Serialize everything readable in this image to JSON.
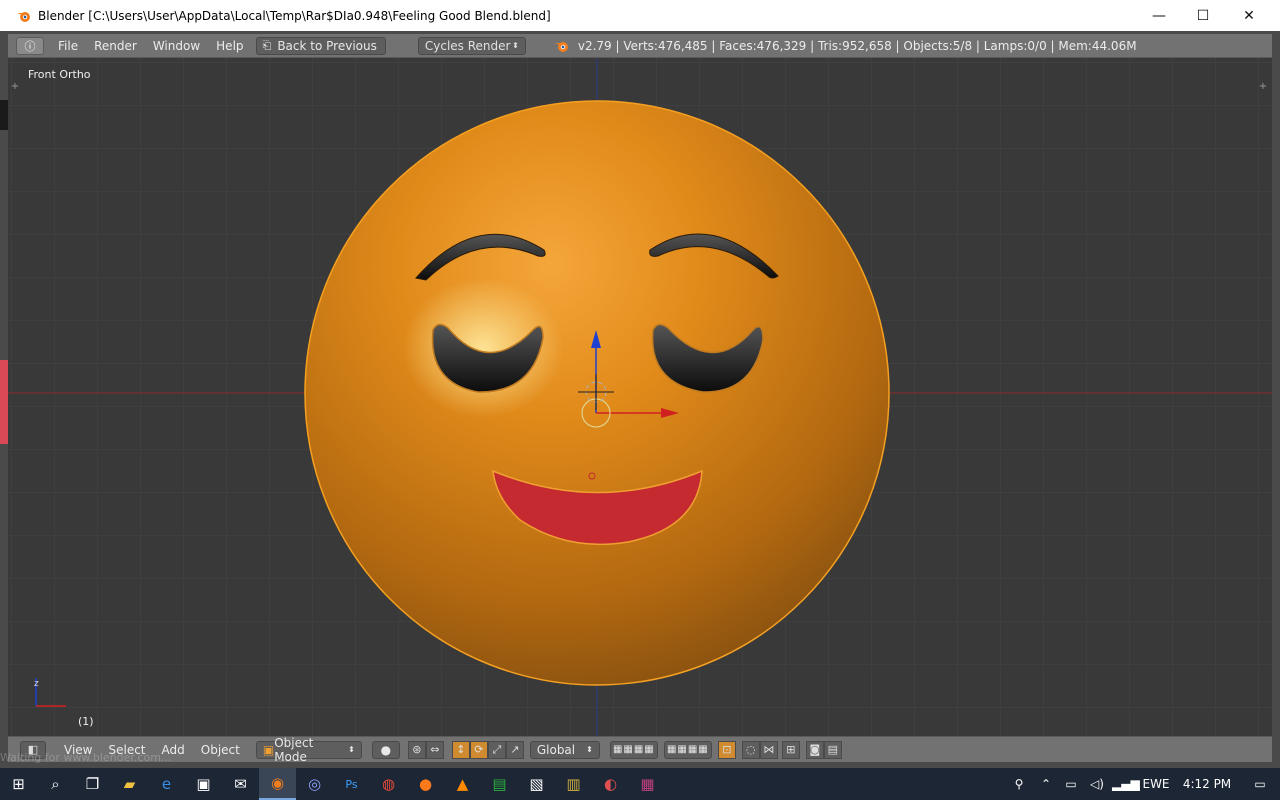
{
  "window": {
    "title": "Blender [C:\\Users\\User\\AppData\\Local\\Temp\\Rar$DIa0.948\\Feeling Good Blend.blend]",
    "controls": {
      "minimize": "—",
      "maximize": "☐",
      "close": "✕"
    }
  },
  "menubar": {
    "items": [
      "File",
      "Render",
      "Window",
      "Help"
    ],
    "back_label": "Back to Previous",
    "render_engine": "Cycles Render",
    "stats": "v2.79 | Verts:476,485 | Faces:476,329 | Tris:952,658 | Objects:5/8 | Lamps:0/0 | Mem:44.06M"
  },
  "viewport": {
    "view_label": "Front Ortho",
    "frame_label": "(1)",
    "axis_z_label": "z"
  },
  "footer": {
    "menus": [
      "View",
      "Select",
      "Add",
      "Object"
    ],
    "mode": "Object Mode",
    "orientation": "Global"
  },
  "status_text": "Waiting for www.blender.com...",
  "taskbar": {
    "language": "EWE",
    "time": "4:12 PM"
  },
  "colors": {
    "viewport_bg": "#393939",
    "grid": "#444444",
    "face": "#e08a1a",
    "mouth": "#c42a30",
    "axis_x": "#d12020",
    "axis_z": "#2040d0"
  }
}
